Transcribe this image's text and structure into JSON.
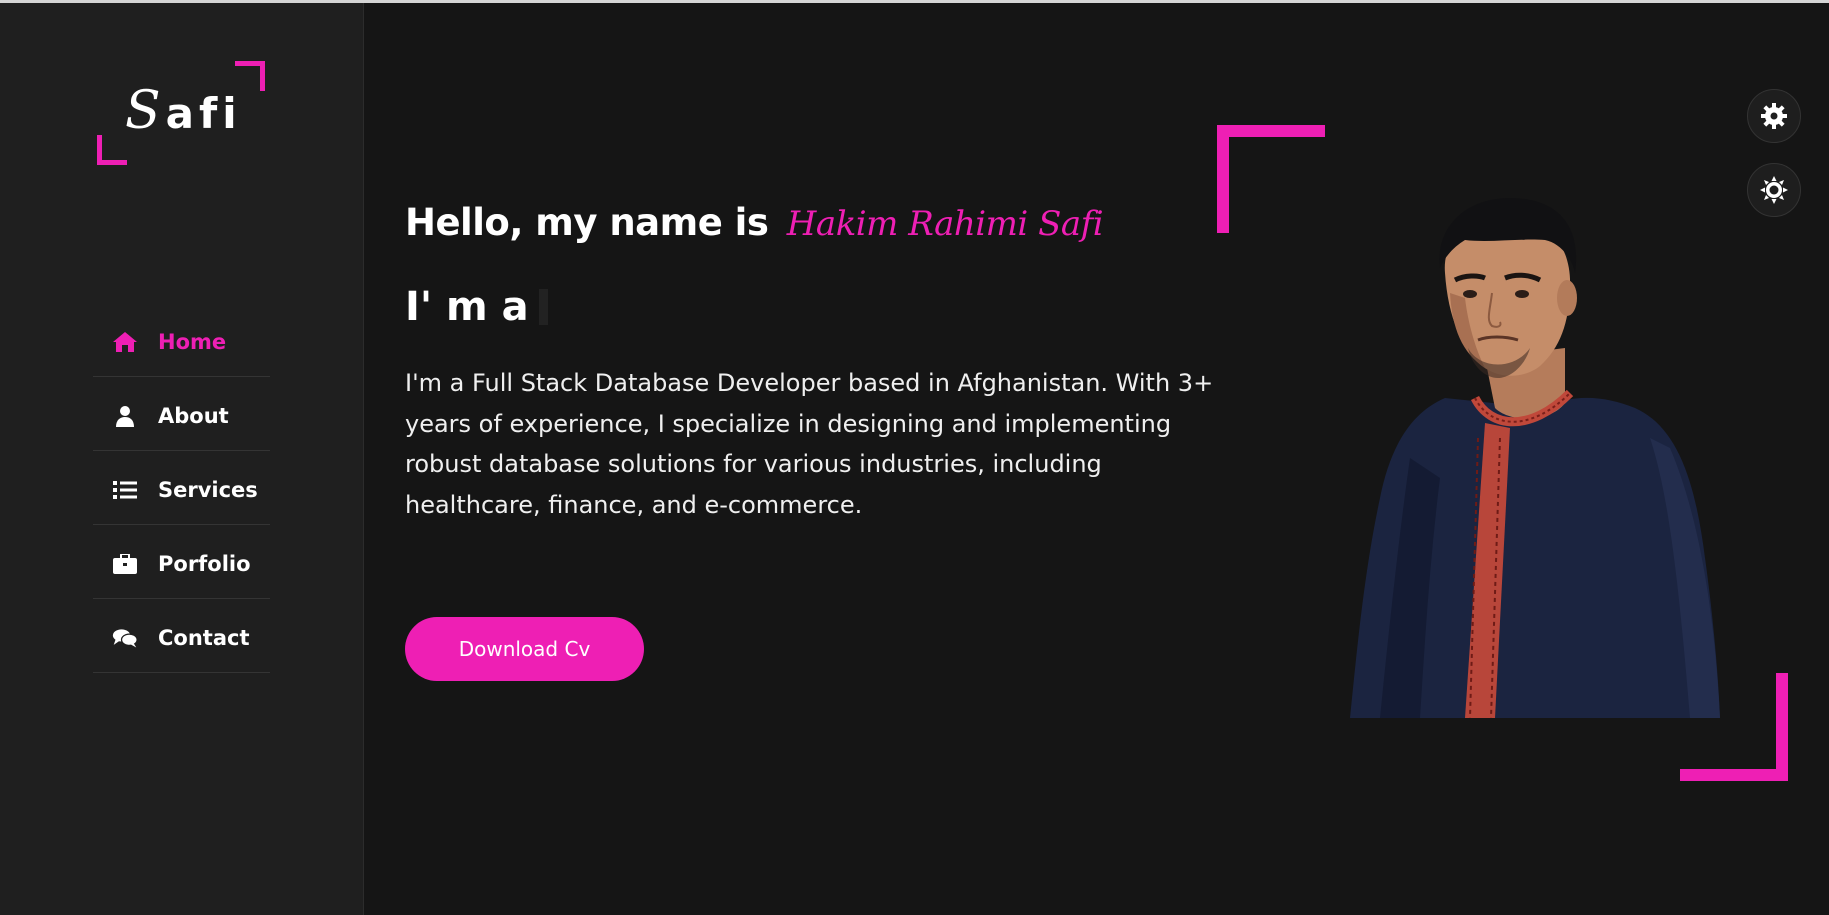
{
  "logo": {
    "first_letter": "S",
    "rest": "afi"
  },
  "nav": {
    "items": [
      {
        "label": "Home",
        "icon": "home-icon",
        "active": true
      },
      {
        "label": "About",
        "icon": "user-icon",
        "active": false
      },
      {
        "label": "Services",
        "icon": "list-icon",
        "active": false
      },
      {
        "label": "Porfolio",
        "icon": "briefcase-icon",
        "active": false
      },
      {
        "label": "Contact",
        "icon": "comments-icon",
        "active": false
      }
    ]
  },
  "hero": {
    "greeting": "Hello, my name is",
    "name": "Hakim Rahimi Safi",
    "typing_prefix": "I' m a",
    "intro": "I'm a Full Stack Database Developer based in Afghanistan. With 3+ years of experience, I specialize in designing and implementing robust database solutions for various industries, including healthcare, finance, and e-commerce.",
    "cta_label": "Download Cv"
  },
  "toolbar": {
    "settings_icon": "gear-icon",
    "theme_icon": "sun-icon"
  },
  "colors": {
    "accent": "#ee1fb4",
    "sidebar_bg": "#1f1f1f",
    "main_bg": "#151515"
  }
}
